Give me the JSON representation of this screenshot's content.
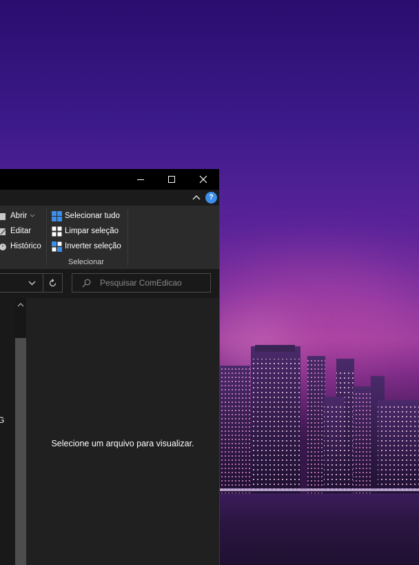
{
  "ribbon": {
    "open_group": [
      {
        "label": "Abrir",
        "icon": "open-icon"
      },
      {
        "label": "Editar",
        "icon": "edit-icon"
      },
      {
        "label": "Histórico",
        "icon": "history-icon"
      }
    ],
    "select_group": {
      "label": "Selecionar",
      "items": [
        {
          "label": "Selecionar tudo",
          "icon": "select-all-icon"
        },
        {
          "label": "Limpar seleção",
          "icon": "clear-selection-icon"
        },
        {
          "label": "Inverter seleção",
          "icon": "invert-selection-icon"
        }
      ]
    }
  },
  "address": {
    "dropdown_icon": "chevron-down-icon",
    "refresh_icon": "refresh-icon"
  },
  "search": {
    "placeholder": "Pesquisar ComEdicao"
  },
  "nav_pane": {
    "partial_item": "G"
  },
  "preview": {
    "message": "Selecione um arquivo para visualizar."
  },
  "colors": {
    "accent_blue": "#3b8eea",
    "window_bg": "#191919",
    "ribbon_bg": "#2b2b2b"
  }
}
